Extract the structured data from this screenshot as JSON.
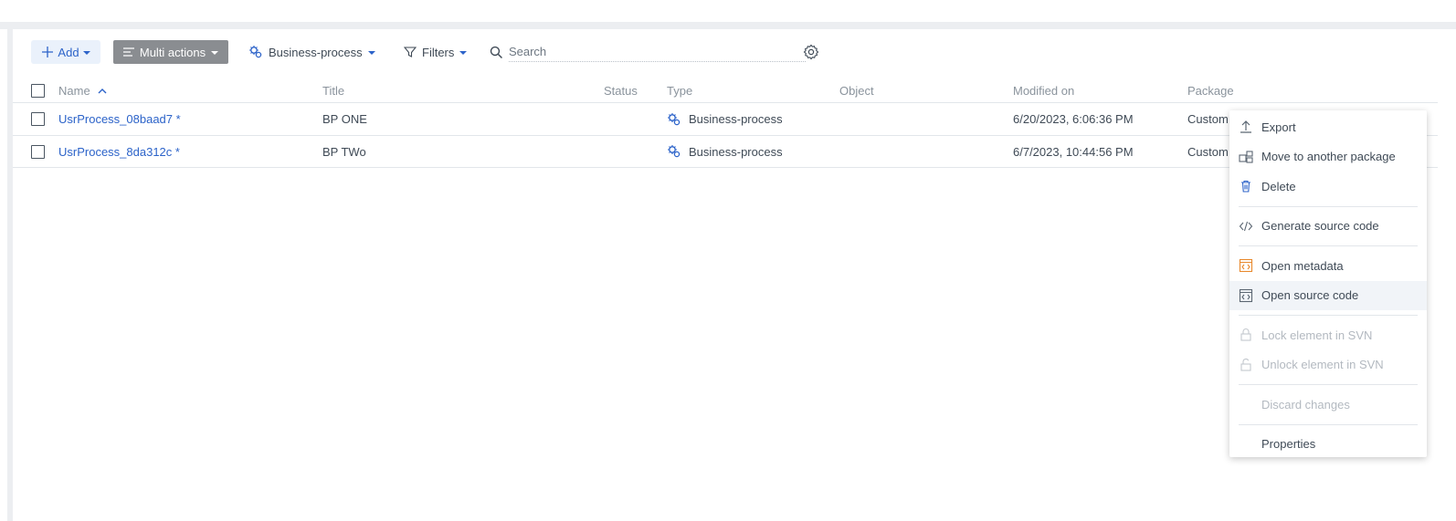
{
  "toolbar": {
    "add_label": "Add",
    "multi_actions_label": "Multi actions",
    "type_filter_label": "Business-process",
    "filters_label": "Filters",
    "search_placeholder": "Search"
  },
  "grid": {
    "columns": {
      "name": "Name",
      "title": "Title",
      "status": "Status",
      "type": "Type",
      "object": "Object",
      "modified": "Modified on",
      "package": "Package"
    },
    "rows": [
      {
        "name": "UsrProcess_08baad7 *",
        "title": "BP ONE",
        "status": "",
        "type": "Business-process",
        "object": "",
        "modified": "6/20/2023, 6:06:36 PM",
        "package": "Custom"
      },
      {
        "name": "UsrProcess_8da312c *",
        "title": "BP TWo",
        "status": "",
        "type": "Business-process",
        "object": "",
        "modified": "6/7/2023, 10:44:56 PM",
        "package": "Custom"
      }
    ]
  },
  "context_menu": {
    "export": "Export",
    "move": "Move to another package",
    "delete": "Delete",
    "generate": "Generate source code",
    "open_metadata": "Open metadata",
    "open_source": "Open source code",
    "lock": "Lock element in SVN",
    "unlock": "Unlock element in SVN",
    "discard": "Discard changes",
    "properties": "Properties"
  },
  "colors": {
    "accent": "#2c63c9",
    "multi_actions_bg": "#8a8d91",
    "metadata_icon": "#e8892d",
    "disabled_text": "#b3b9c0"
  },
  "icons": {
    "add": "plus-icon",
    "multi": "list-icon",
    "type": "business-process-icon",
    "filters": "funnel-icon",
    "search": "search-icon",
    "settings": "gear-icon",
    "sort": "sort-ascending-icon"
  }
}
